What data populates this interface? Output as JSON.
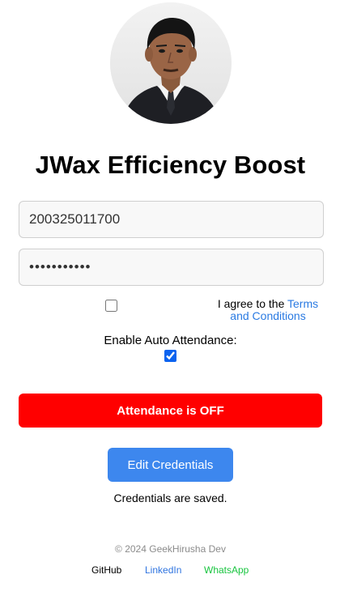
{
  "app": {
    "title": "JWax Efficiency Boost"
  },
  "form": {
    "username_value": "200325011700",
    "password_value": "•••••••••••",
    "terms": {
      "checked": false,
      "text_prefix": "I agree to the ",
      "link_text": "Terms and Conditions"
    },
    "auto_attendance": {
      "label": "Enable Auto Attendance:",
      "checked": true
    }
  },
  "buttons": {
    "attendance_label": "Attendance is OFF",
    "attendance_color": "#ff0000",
    "edit_label": "Edit Credentials",
    "edit_color": "#3d87ee"
  },
  "status": {
    "message": "Credentials are saved."
  },
  "footer": {
    "copyright": "© 2024 GeekHirusha Dev",
    "links": [
      {
        "label": "GitHub",
        "color": "#000000"
      },
      {
        "label": "LinkedIn",
        "color": "#2f74e0"
      },
      {
        "label": "WhatsApp",
        "color": "#17c43e"
      }
    ]
  }
}
